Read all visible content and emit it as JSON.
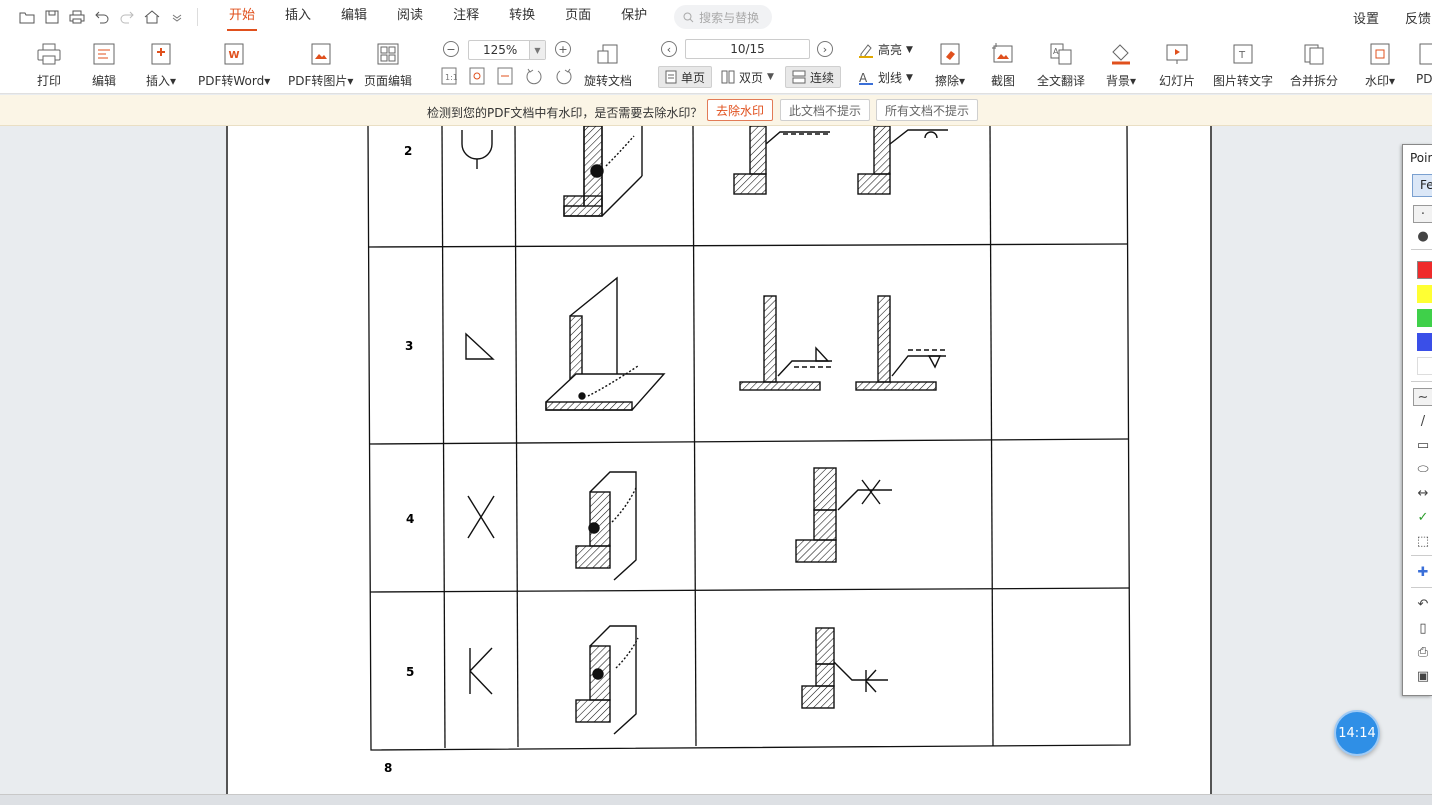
{
  "toolbar": {
    "tabs": [
      "开始",
      "插入",
      "编辑",
      "阅读",
      "注释",
      "转换",
      "页面",
      "保护"
    ],
    "search_placeholder": "搜索与替换",
    "right": {
      "settings": "设置",
      "feedback": "反馈"
    }
  },
  "ribbon": {
    "buttons": {
      "print": "打印",
      "edit": "编辑",
      "insert": "插入▾",
      "pdf_to_word": "PDF转Word▾",
      "pdf_to_image": "PDF转图片▾",
      "page_edit": "页面编辑",
      "rotate": "旋转文档",
      "erase": "擦除▾",
      "screenshot": "截图",
      "translate": "全文翻译",
      "background": "背景▾",
      "slideshow": "幻灯片",
      "image_to_text": "图片转文字",
      "merge_split": "合并拆分",
      "watermark": "水印▾",
      "pdf_cut": "PD"
    },
    "zoom": "125%",
    "page_indicator": "10/15",
    "view": {
      "single": "单页",
      "double": "双页",
      "continuous": "连续"
    },
    "highlight": "高亮",
    "strike": "划线"
  },
  "notice": {
    "message": "检测到您的PDF文档中有水印，是否需要去除水印？",
    "remove": "去除水印",
    "ignore_doc": "此文档不提示",
    "ignore_all": "所有文档不提示"
  },
  "document": {
    "row_numbers": [
      "2",
      "3",
      "4",
      "5"
    ],
    "page_number": "8"
  },
  "pointofix": {
    "title": "Poin",
    "button": "Fe",
    "colors": [
      "#ef2b2b",
      "#ffff33",
      "#3fd04a",
      "#3a4fe8",
      "#ffffff"
    ]
  },
  "clock": "14:14"
}
